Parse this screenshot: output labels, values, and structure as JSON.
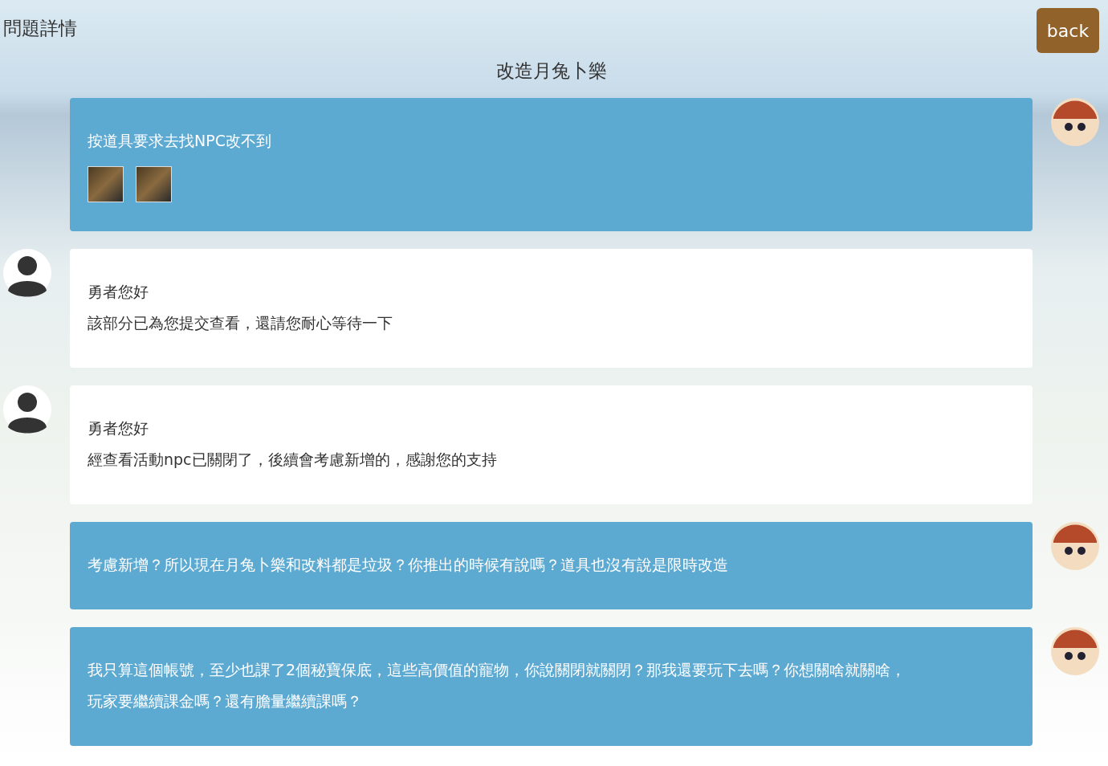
{
  "page": {
    "title": "問題詳情",
    "back_button": "back",
    "subject": "改造月兔卜樂"
  },
  "messages": [
    {
      "kind": "user",
      "lines": [
        "按道具要求去找NPC改不到"
      ],
      "attachments": [
        {
          "kind": "image"
        },
        {
          "kind": "image"
        }
      ]
    },
    {
      "kind": "staff",
      "lines": [
        "勇者您好",
        "該部分已為您提交查看，還請您耐心等待一下"
      ]
    },
    {
      "kind": "staff",
      "lines": [
        "勇者您好",
        "經查看活動npc已關閉了，後續會考慮新增的，感謝您的支持"
      ]
    },
    {
      "kind": "user",
      "lines": [
        "考慮新增？所以現在月兔卜樂和改料都是垃圾？你推出的時候有說嗎？道具也沒有說是限時改造"
      ]
    },
    {
      "kind": "user",
      "lines": [
        "我只算這個帳號，至少也課了2個秘寶保底，這些高價值的寵物，你說關閉就關閉？那我還要玩下去嗎？你想關啥就關啥，",
        "玩家要繼續課金嗎？還有膽量繼續課嗎？"
      ]
    }
  ]
}
